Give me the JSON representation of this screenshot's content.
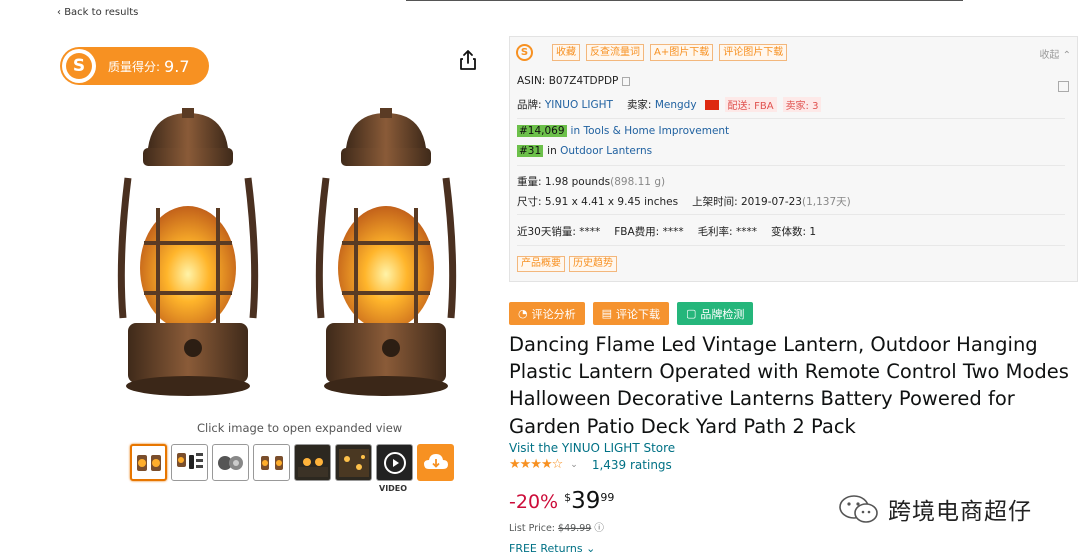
{
  "nav": {
    "back_label": "Back to results"
  },
  "score": {
    "logo_letter": "S",
    "label": "质量得分:",
    "value": "9.7"
  },
  "gallery": {
    "hint": "Click image to open expanded view",
    "video_label": "VIDEO",
    "thumbnails": [
      "lantern-pair",
      "lantern-remote",
      "lantern-parts",
      "lantern-pair-small",
      "lantern-night",
      "lantern-lifestyle",
      "video-play",
      "download"
    ]
  },
  "plugin": {
    "logo_letter": "S",
    "tags": [
      "收藏",
      "反查流量词",
      "A+图片下载",
      "评论图片下载"
    ],
    "collapse_label": "收起",
    "asin_label": "ASIN:",
    "asin": "B07Z4TDPDP",
    "brand_label": "品牌:",
    "brand": "YINUO LIGHT",
    "seller_label": "卖家:",
    "seller": "Mengdy",
    "fulfillment": "配送: FBA",
    "sellers_count": "卖家: 3",
    "rank1": {
      "rank": "#14,069",
      "in": "in",
      "category": "Tools & Home Improvement"
    },
    "rank2": {
      "rank": "#31",
      "in": "in",
      "category": "Outdoor Lanterns"
    },
    "weight_label": "重量:",
    "weight": "1.98 pounds",
    "weight_g": "(898.11 g)",
    "size_label": "尺寸:",
    "size": "5.91 x 4.41 x 9.45 inches",
    "listed_label": "上架时间:",
    "listed": "2019-07-23",
    "listed_days": "(1,137天)",
    "sales_label": "近30天销量:",
    "sales": "****",
    "fba_label": "FBA费用:",
    "fba": "****",
    "margin_label": "毛利率:",
    "margin": "****",
    "variants_label": "变体数:",
    "variants": "1",
    "foot_tags": [
      "产品概要",
      "历史趋势"
    ]
  },
  "actions": [
    {
      "label": "评论分析",
      "color": "#f5932f"
    },
    {
      "label": "评论下载",
      "color": "#f5932f"
    },
    {
      "label": "品牌检测",
      "color": "#25b67b"
    }
  ],
  "product": {
    "title": "Dancing Flame Led Vintage Lantern, Outdoor Hanging Plastic Lantern Operated with Remote Control Two Modes Halloween Decorative Lanterns Battery Powered for Garden Patio Deck Yard Path 2 Pack",
    "store": "Visit the YINUO LIGHT Store",
    "stars": "★★★★☆",
    "rating_value": 4.5,
    "ratings": "1,439 ratings",
    "discount": "-20%",
    "currency": "$",
    "price_whole": "39",
    "price_cents": "99",
    "list_price_label": "List Price:",
    "list_price": "$49.99",
    "info_icon": "ⓘ",
    "free_returns": "FREE Returns",
    "chevron": "⌄"
  },
  "watermark": {
    "text": "跨境电商超仔"
  }
}
